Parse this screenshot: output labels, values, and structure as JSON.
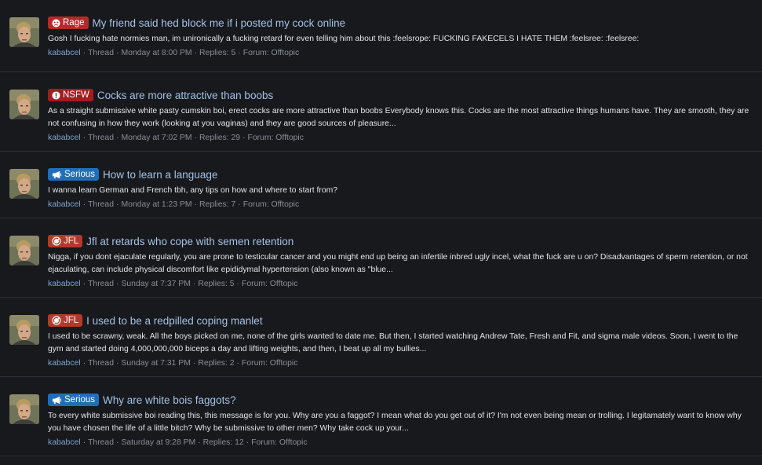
{
  "threads": [
    {
      "prefix": {
        "label": "Rage",
        "color": "#b8272a",
        "icon": "angry-face-icon"
      },
      "title": "My friend said hed block me if i posted my cock online",
      "snippet": "Gosh I fucking hate normies man, im unironically a fucking retard for even telling him about this :feelsrope: FUCKING FAKECELS I HATE THEM :feelsree: :feelsree:",
      "author": "kababcel",
      "type": "Thread",
      "date": "Monday at 8:00 PM",
      "replies": "Replies: 5",
      "forum": "Forum: Offtopic"
    },
    {
      "prefix": {
        "label": "NSFW",
        "color": "#a11d22",
        "icon": "exclamation-circle-icon"
      },
      "title": "Cocks are more attractive than boobs",
      "snippet": "As a straight submissive white pasty cumskin boi, erect cocks are more attractive than boobs Everybody knows this. Cocks are the most attractive things humans have. They are smooth, they are not confusing in how they work (looking at you vaginas) and they are good sources of pleasure...",
      "author": "kababcel",
      "type": "Thread",
      "date": "Monday at 7:02 PM",
      "replies": "Replies: 29",
      "forum": "Forum: Offtopic"
    },
    {
      "prefix": {
        "label": "Serious",
        "color": "#1f6fb8",
        "icon": "megaphone-icon"
      },
      "title": "How to learn a language",
      "snippet": "I wanna learn German and French tbh, any tips on how and where to start from?",
      "author": "kababcel",
      "type": "Thread",
      "date": "Monday at 1:23 PM",
      "replies": "Replies: 7",
      "forum": "Forum: Offtopic"
    },
    {
      "prefix": {
        "label": "JFL",
        "color": "#b23a2a",
        "icon": "no-laughing-icon"
      },
      "title": "Jfl at retards who cope with semen retention",
      "snippet": "Nigga, if you dont ejaculate regularly, you are prone to testicular cancer and you might end up being an infertile inbred ugly incel, what the fuck are u on? Disadvantages of sperm retention, or not ejaculating, can include physical discomfort like epididymal hypertension (also known as \"blue...",
      "author": "kababcel",
      "type": "Thread",
      "date": "Sunday at 7:37 PM",
      "replies": "Replies: 5",
      "forum": "Forum: Offtopic"
    },
    {
      "prefix": {
        "label": "JFL",
        "color": "#b23a2a",
        "icon": "no-laughing-icon"
      },
      "title": "I used to be a redpilled coping manlet",
      "snippet": "I used to be scrawny, weak. All the boys picked on me, none of the girls wanted to date me. But then, I started watching Andrew Tate, Fresh and Fit, and sigma male videos. Soon, I went to the gym and started doing 4,000,000,000 biceps a day and lifting weights, and then, I beat up all my bullies...",
      "author": "kababcel",
      "type": "Thread",
      "date": "Sunday at 7:31 PM",
      "replies": "Replies: 2",
      "forum": "Forum: Offtopic"
    },
    {
      "prefix": {
        "label": "Serious",
        "color": "#1f6fb8",
        "icon": "megaphone-icon"
      },
      "title": "Why are white bois faggots?",
      "snippet": "To every white submissive boi reading this, this message is for you. Why are you a faggot? I mean what do you get out of it? I'm not even being mean or trolling. I legitamately want to know why you have chosen the life of a little bitch? Why be submissive to other men? Why take cock up your...",
      "author": "kababcel",
      "type": "Thread",
      "date": "Saturday at 9:28 PM",
      "replies": "Replies: 12",
      "forum": "Forum: Offtopic"
    }
  ]
}
